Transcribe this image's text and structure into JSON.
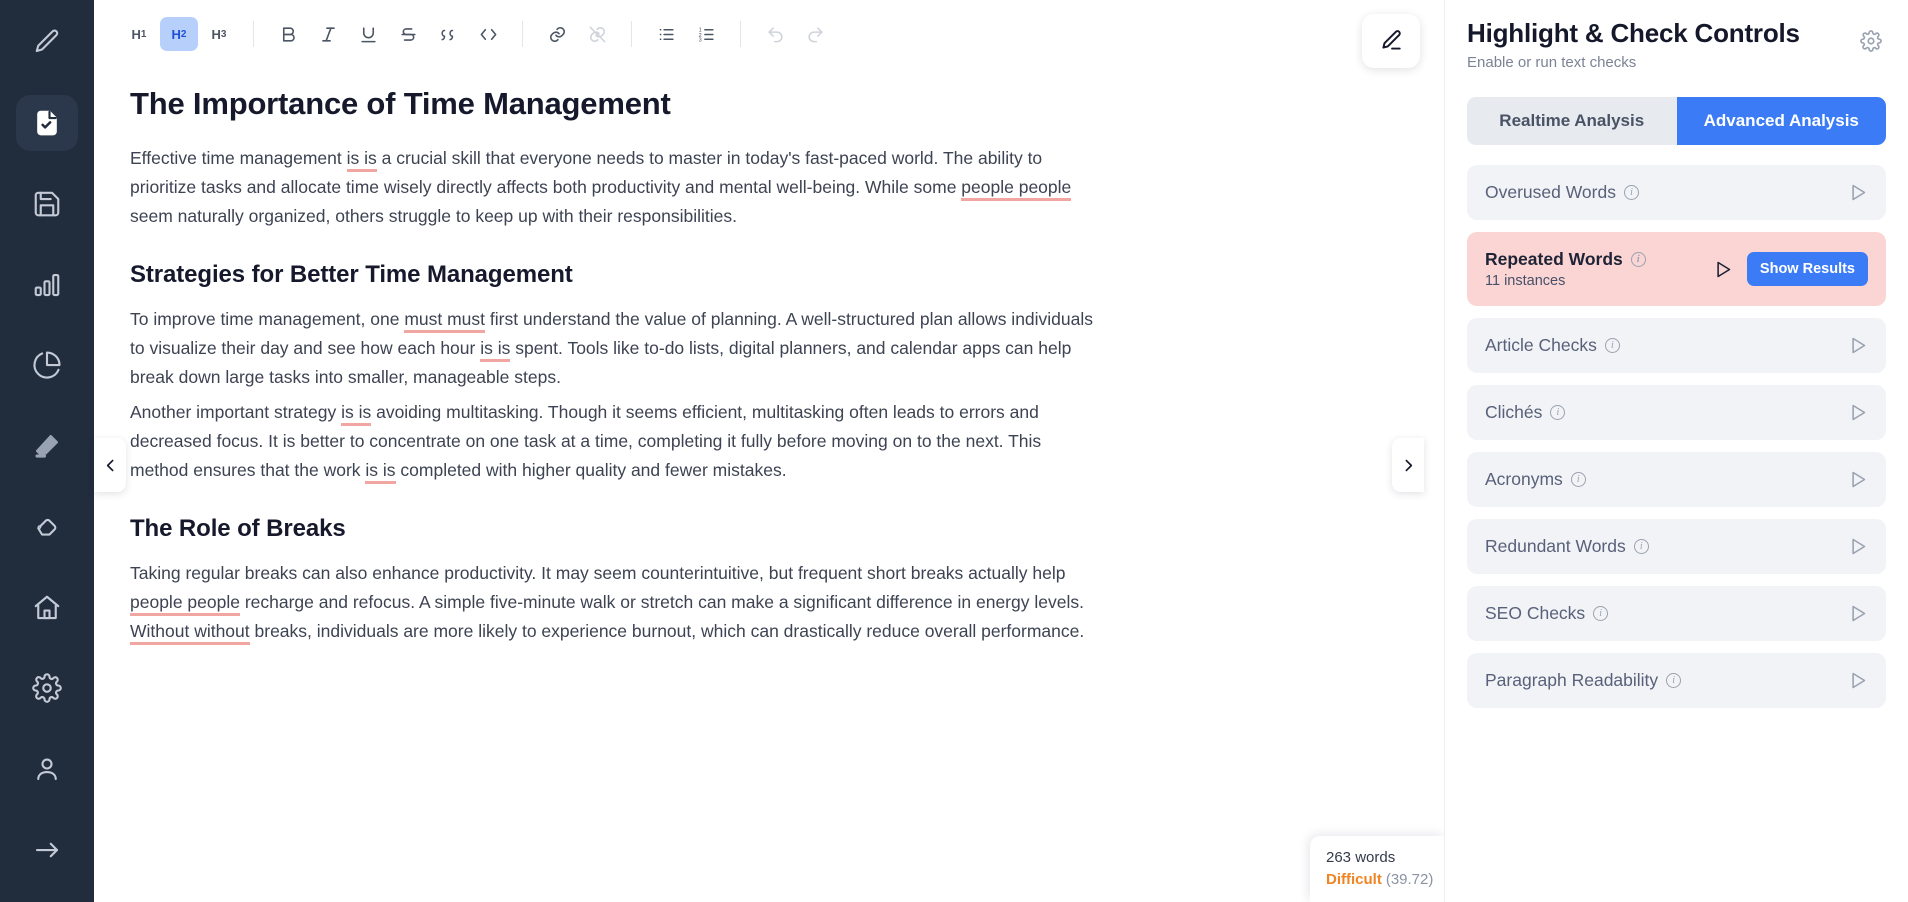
{
  "rail": {
    "items": [
      {
        "icon": "pencil-icon",
        "name": "rail-item-write",
        "active": false
      },
      {
        "icon": "document-check-icon",
        "name": "rail-item-document",
        "active": true
      },
      {
        "icon": "save-icon",
        "name": "rail-item-save",
        "active": false
      },
      {
        "icon": "bar-chart-icon",
        "name": "rail-item-stats",
        "active": false
      },
      {
        "icon": "pie-chart-icon",
        "name": "rail-item-analytics",
        "active": false
      },
      {
        "icon": "highlighter-icon",
        "name": "rail-item-highlight",
        "active": false
      },
      {
        "icon": "eraser-icon",
        "name": "rail-item-eraser",
        "active": false
      },
      {
        "icon": "home-icon",
        "name": "rail-item-home",
        "active": false
      },
      {
        "icon": "gear-icon",
        "name": "rail-item-settings",
        "active": false
      },
      {
        "icon": "user-icon",
        "name": "rail-item-account",
        "active": false
      },
      {
        "icon": "arrow-right-icon",
        "name": "rail-item-logout",
        "active": false
      }
    ]
  },
  "toolbar": {
    "h1_label": "H",
    "h1_sub": "1",
    "h2_label": "H",
    "h2_sub": "2",
    "h3_label": "H",
    "h3_sub": "3",
    "bold_label": "B",
    "italic_label": "I",
    "underline_label": "U",
    "strike_label": "S",
    "quote_label": "””",
    "code_label": "</>",
    "active_heading": "H2"
  },
  "editor": {
    "title": "The Importance of Time Management",
    "blocks": [
      {
        "type": "p",
        "runs": [
          {
            "t": "Effective time management ",
            "h": false
          },
          {
            "t": "is is",
            "h": true
          },
          {
            "t": " a crucial skill that everyone needs to master in today's fast-paced world. The ability to prioritize tasks and allocate time wisely directly affects both productivity and mental well-being. While some ",
            "h": false
          },
          {
            "t": "people people",
            "h": true
          },
          {
            "t": " seem naturally organized, others struggle to keep up with their responsibilities.",
            "h": false
          }
        ]
      },
      {
        "type": "h2",
        "runs": [
          {
            "t": "Strategies for Better Time Management",
            "h": false
          }
        ]
      },
      {
        "type": "p",
        "runs": [
          {
            "t": "To improve time management, one ",
            "h": false
          },
          {
            "t": "must must",
            "h": true
          },
          {
            "t": " first understand the value of planning. A well-structured plan allows individuals to visualize their day and see how each hour ",
            "h": false
          },
          {
            "t": "is is",
            "h": true
          },
          {
            "t": " spent. Tools like to-do lists, digital planners, and calendar apps can help break down large tasks into smaller, manageable steps.",
            "h": false
          }
        ]
      },
      {
        "type": "p",
        "runs": [
          {
            "t": "Another important strategy ",
            "h": false
          },
          {
            "t": "is is",
            "h": true
          },
          {
            "t": " avoiding multitasking. Though it seems efficient, multitasking often leads to errors and decreased focus. It is better to concentrate on one task at a time, completing it fully before moving on to the next. This method ensures that the work ",
            "h": false
          },
          {
            "t": "is is",
            "h": true
          },
          {
            "t": " completed with higher quality and fewer mistakes.",
            "h": false
          }
        ]
      },
      {
        "type": "h2",
        "runs": [
          {
            "t": "The Role of Breaks",
            "h": false
          }
        ]
      },
      {
        "type": "p",
        "runs": [
          {
            "t": "Taking regular breaks can also enhance productivity. It may seem counterintuitive, but frequent short breaks actually help ",
            "h": false
          },
          {
            "t": "people people",
            "h": true
          },
          {
            "t": " recharge and refocus. A simple five-minute walk or stretch can make a significant difference in energy levels. ",
            "h": false
          },
          {
            "t": "Without without",
            "h": true
          },
          {
            "t": " breaks, individuals are more likely to experience burnout, which can drastically reduce overall performance.",
            "h": false
          }
        ]
      }
    ]
  },
  "word_badge": {
    "count": "263 words",
    "grade": "Difficult",
    "score": "(39.72)",
    "grade_color": "#f08422"
  },
  "panel": {
    "title": "Highlight & Check Controls",
    "subtitle": "Enable or run text checks",
    "tabs": [
      {
        "label": "Realtime Analysis",
        "active": false
      },
      {
        "label": "Advanced Analysis",
        "active": true
      }
    ],
    "accent_color": "#3b7cf6",
    "alert_bg": "#fbd5d3",
    "checks": [
      {
        "label": "Overused Words",
        "sub": "",
        "alert": false,
        "action": ""
      },
      {
        "label": "Repeated Words",
        "sub": "11 instances",
        "alert": true,
        "action": "Show Results"
      },
      {
        "label": "Article Checks",
        "sub": "",
        "alert": false,
        "action": ""
      },
      {
        "label": "Clichés",
        "sub": "",
        "alert": false,
        "action": ""
      },
      {
        "label": "Acronyms",
        "sub": "",
        "alert": false,
        "action": ""
      },
      {
        "label": "Redundant Words",
        "sub": "",
        "alert": false,
        "action": ""
      },
      {
        "label": "SEO Checks",
        "sub": "",
        "alert": false,
        "action": ""
      },
      {
        "label": "Paragraph Readability",
        "sub": "",
        "alert": false,
        "action": ""
      }
    ]
  }
}
